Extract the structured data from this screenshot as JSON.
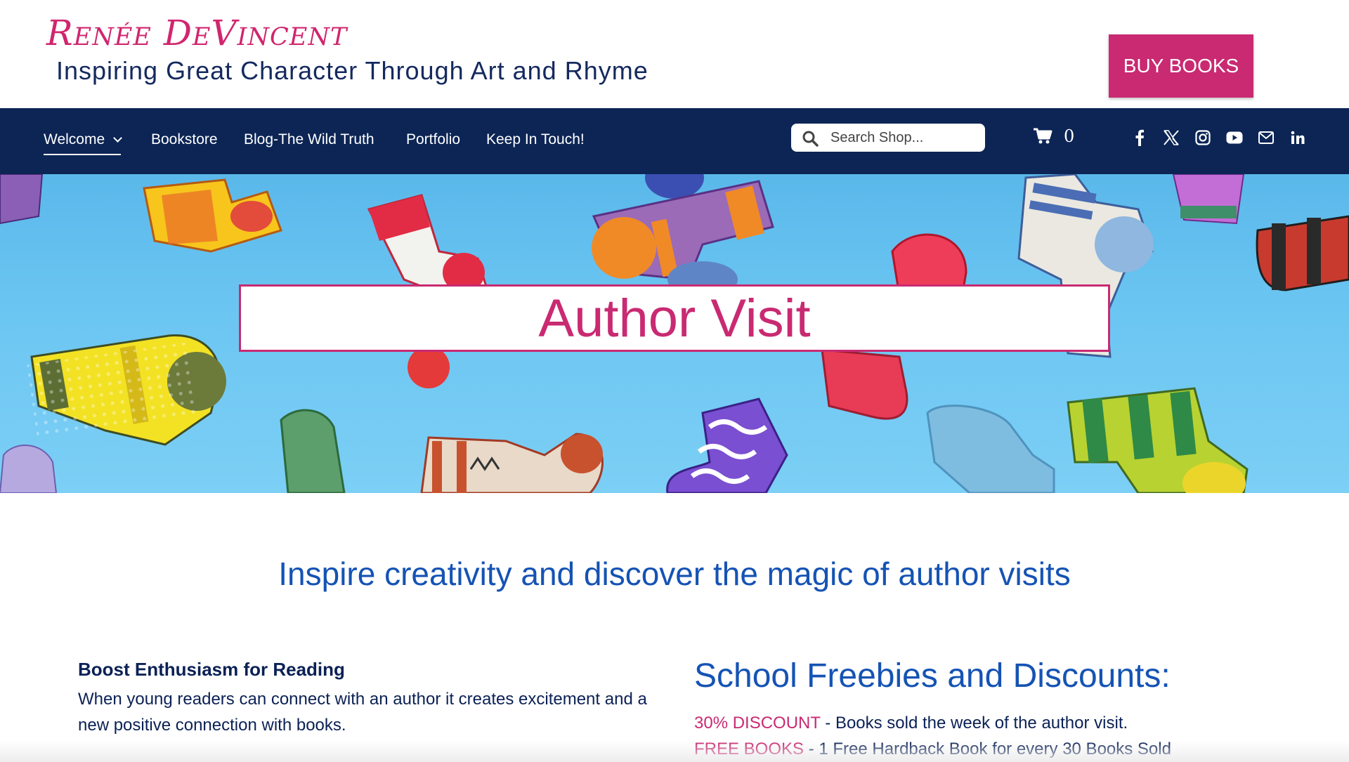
{
  "header": {
    "brand_name": "Renée DeVincent",
    "tagline": "Inspiring Great Character Through Art and Rhyme",
    "buy_button": "BUY BOOKS"
  },
  "nav": {
    "items": [
      {
        "label": "Welcome",
        "active": true,
        "has_dropdown": true
      },
      {
        "label": "Bookstore"
      },
      {
        "label": "Blog-The Wild Truth"
      },
      {
        "label": "Portfolio"
      },
      {
        "label": "Keep In Touch!"
      }
    ],
    "search_placeholder": "Search Shop...",
    "cart_count": "0",
    "social_icons": [
      "facebook-icon",
      "x-icon",
      "instagram-icon",
      "youtube-icon",
      "email-icon",
      "linkedin-icon"
    ]
  },
  "hero": {
    "title": "Author Visit"
  },
  "content": {
    "intro_heading": "Inspire creativity and discover the magic of author visits",
    "boost": {
      "heading": "Boost Enthusiasm for Reading",
      "text": "When young readers can connect with an author it creates excitement and a new positive connection with books."
    },
    "freebies": {
      "heading": "School Freebies and Discounts:",
      "items": [
        {
          "highlight": "30% DISCOUNT",
          "text": " - Books sold the week of the author visit."
        },
        {
          "highlight": "FREE BOOKS",
          "text": " - 1 Free Hardback Book for every 30 Books Sold"
        }
      ]
    }
  },
  "colors": {
    "accent_pink": "#c92a72",
    "nav_navy": "#0c2555",
    "heading_blue": "#1553b4",
    "hero_sky": "#6cc6f2"
  }
}
